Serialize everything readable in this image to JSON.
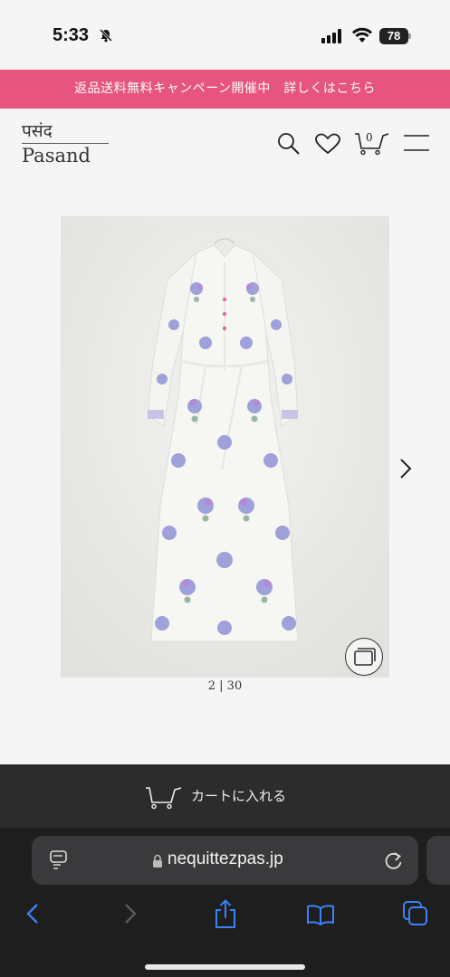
{
  "status_bar": {
    "time": "5:33",
    "battery": "78"
  },
  "promo": {
    "text": "返品送料無料キャンペーン開催中　詳しくはこちら"
  },
  "header": {
    "logo_hindi": "पसंद",
    "logo_latin": "Pasand",
    "cart_count": "0"
  },
  "product": {
    "counter": "2 | 30"
  },
  "cart": {
    "button_label": "カートに入れる"
  },
  "browser": {
    "url": "nequittezpas.jp"
  },
  "colors": {
    "promo_bg": "#e7547d",
    "cart_bar_bg": "#2c2c2c",
    "safari_accent": "#3a82f7"
  },
  "icons": [
    "bell-slash-icon",
    "signal-icon",
    "wifi-icon",
    "battery-icon",
    "search-icon",
    "heart-icon",
    "cart-icon",
    "hamburger-icon",
    "next-arrow-icon",
    "gallery-icon",
    "tab-menu-icon",
    "lock-icon",
    "reload-icon",
    "back-icon",
    "forward-icon",
    "share-icon",
    "bookmarks-icon",
    "tabs-icon"
  ]
}
